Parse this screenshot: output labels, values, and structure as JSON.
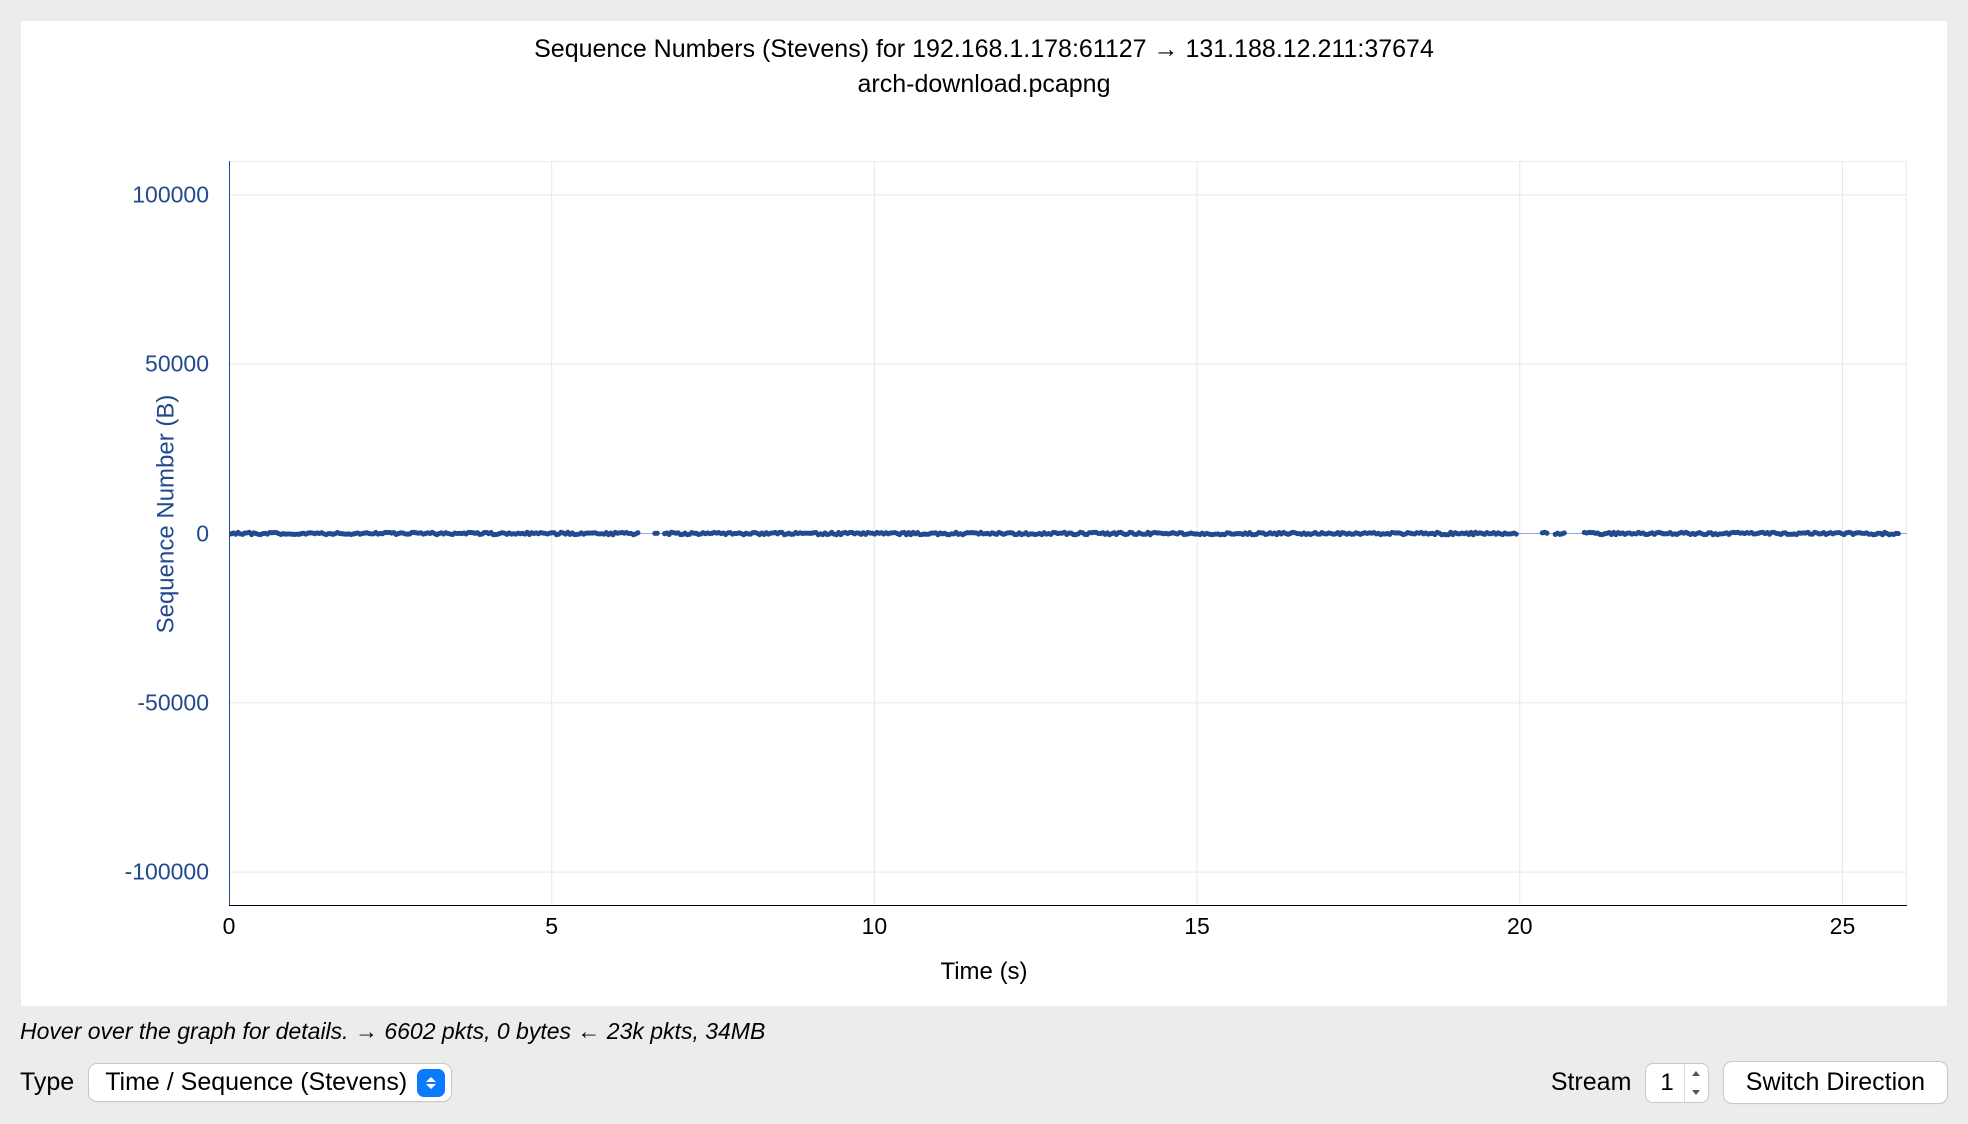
{
  "title": "Sequence Numbers (Stevens) for 192.168.1.178:61127 → 131.188.12.211:37674",
  "subtitle": "arch-download.pcapng",
  "hint": "Hover over the graph for details. → 6602 pkts, 0 bytes ← 23k pkts, 34MB",
  "toolbar": {
    "type_label": "Type",
    "type_value": "Time / Sequence (Stevens)",
    "stream_label": "Stream",
    "stream_value": "1",
    "switch_label": "Switch Direction"
  },
  "chart_data": {
    "type": "scatter",
    "title": "Sequence Numbers (Stevens) for 192.168.1.178:61127 → 131.188.12.211:37674",
    "subtitle": "arch-download.pcapng",
    "xlabel": "Time (s)",
    "ylabel": "Sequence Number (B)",
    "xlim": [
      0,
      26
    ],
    "ylim": [
      -110000,
      110000
    ],
    "x_ticks": [
      0,
      5,
      10,
      15,
      20,
      25
    ],
    "y_ticks": [
      -100000,
      -50000,
      0,
      50000,
      100000
    ],
    "series": [
      {
        "name": "seq",
        "color": "#224a8d",
        "y_constant": 0,
        "x_segments": [
          [
            0.0,
            6.35
          ],
          [
            6.6,
            6.65
          ],
          [
            6.75,
            19.95
          ],
          [
            20.35,
            20.45
          ],
          [
            20.55,
            20.7
          ],
          [
            21.0,
            25.9
          ]
        ]
      }
    ]
  }
}
